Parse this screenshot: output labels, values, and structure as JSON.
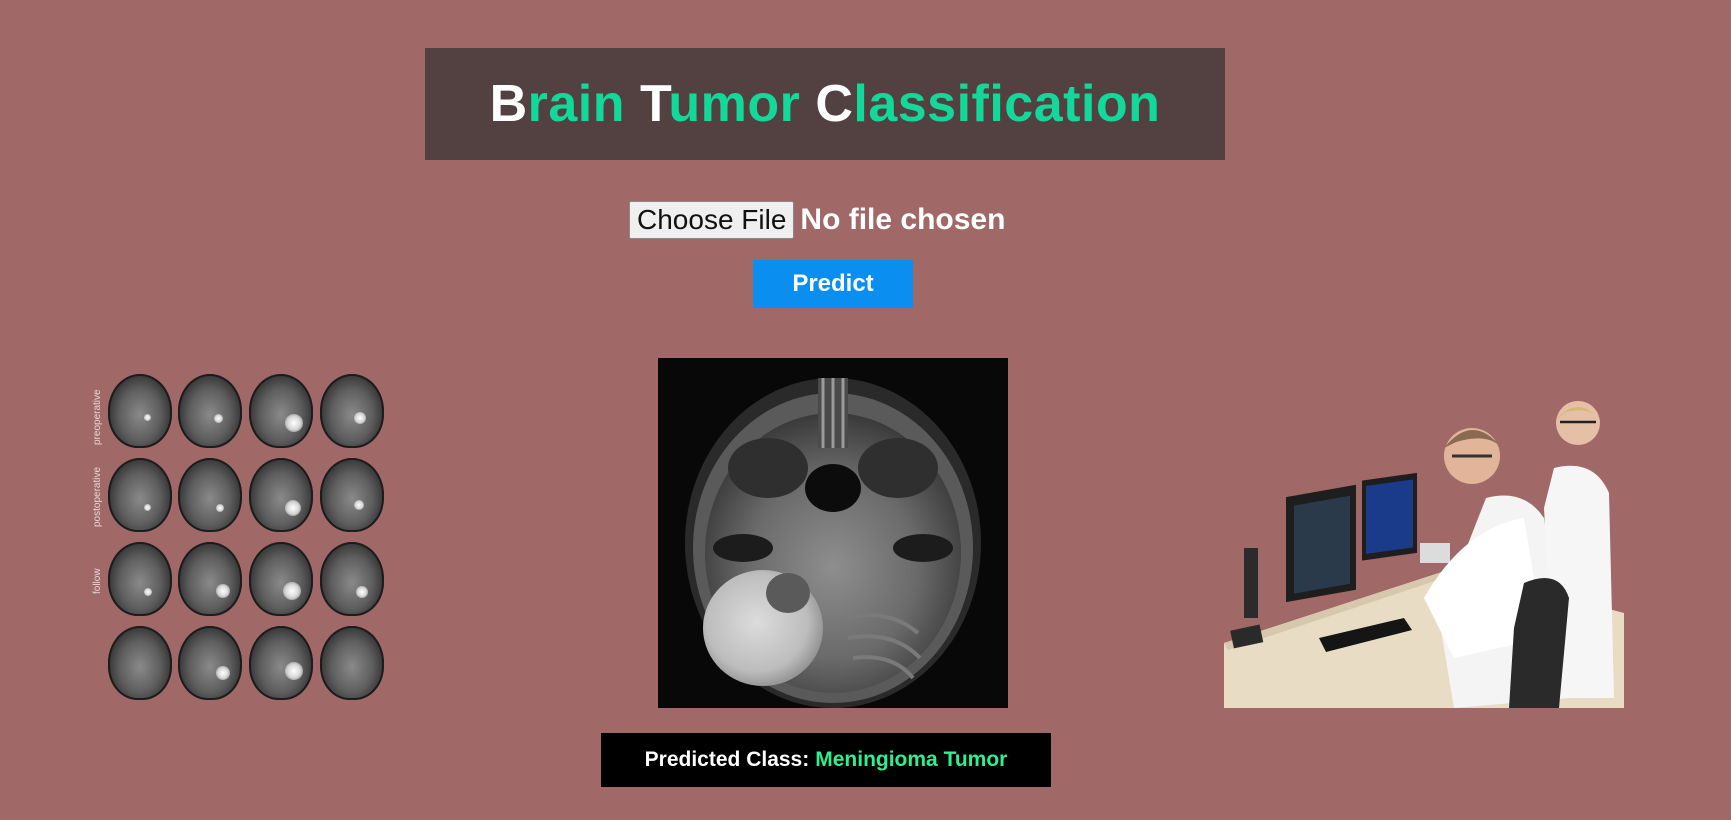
{
  "header": {
    "title_words": [
      {
        "cap": "B",
        "rest": "rain"
      },
      {
        "cap": "T",
        "rest": "umor"
      },
      {
        "cap": "C",
        "rest": "lassification"
      }
    ]
  },
  "upload": {
    "choose_file_label": "Choose File",
    "file_status": "No file chosen"
  },
  "predict_button_label": "Predict",
  "result": {
    "label": "Predicted Class:",
    "value": "Meningioma Tumor"
  },
  "mri_grid": {
    "row_labels": [
      "preoperative",
      "postoperative",
      "follow",
      ""
    ]
  },
  "colors": {
    "background": "#a06867",
    "title_box": "#534141",
    "title_accent": "#12d99a",
    "button": "#0a8ff0",
    "result_value": "#2ef08e"
  },
  "images": {
    "left": "brain-mri-grid-image",
    "center": "uploaded-mri-scan-image",
    "right": "radiologists-at-workstation-image"
  }
}
